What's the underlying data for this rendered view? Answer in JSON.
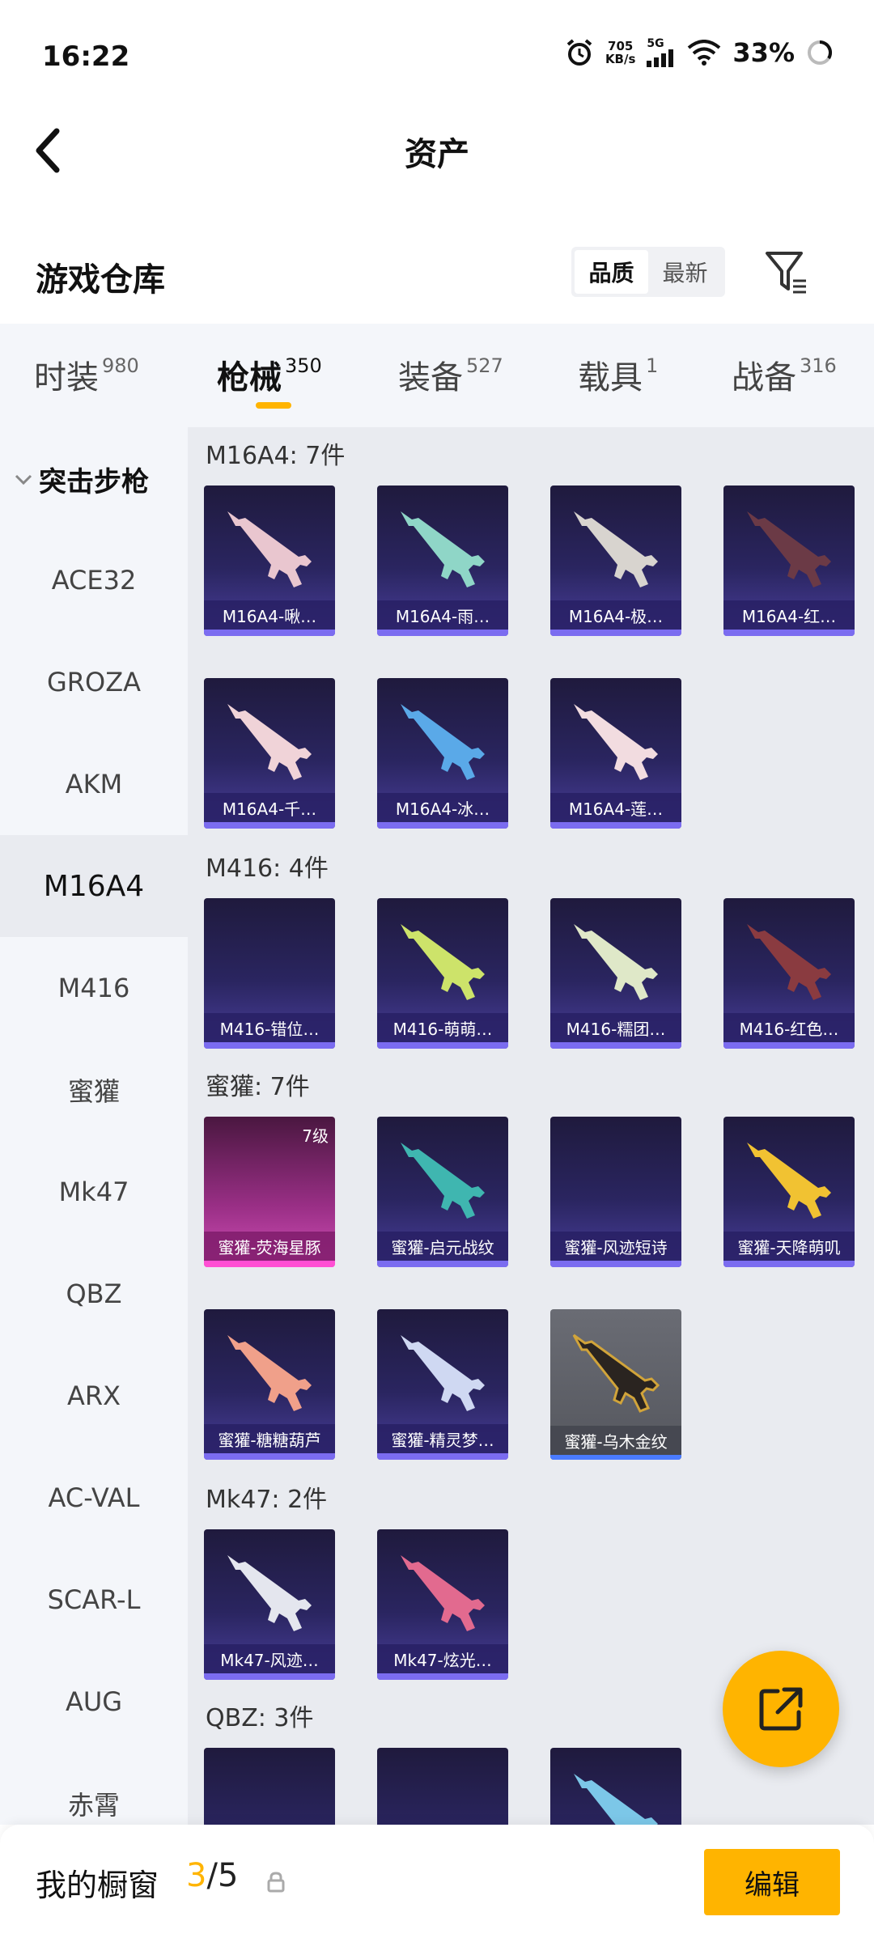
{
  "status_bar": {
    "time": "16:22",
    "net_speed_value": "705",
    "net_speed_unit": "KB/s",
    "network": "5G",
    "battery": "33%"
  },
  "header": {
    "title": "资产"
  },
  "warehouse": {
    "title": "游戏仓库",
    "sort_options": [
      "品质",
      "最新"
    ],
    "active_sort": "品质"
  },
  "tabs": [
    {
      "label": "时装",
      "count": "980"
    },
    {
      "label": "枪械",
      "count": "350"
    },
    {
      "label": "装备",
      "count": "527"
    },
    {
      "label": "载具",
      "count": "1"
    },
    {
      "label": "战备",
      "count": "316"
    }
  ],
  "active_tab": "枪械",
  "sidebar": {
    "group": "突击步枪",
    "items": [
      "ACE32",
      "GROZA",
      "AKM",
      "M16A4",
      "M416",
      "蜜獾",
      "Mk47",
      "QBZ",
      "ARX",
      "AC-VAL",
      "SCAR-L",
      "AUG",
      "赤霄"
    ],
    "active": "M16A4"
  },
  "sections": [
    {
      "title": "M16A4: 7件",
      "items": [
        "M16A4-啾…",
        "M16A4-雨…",
        "M16A4-极…",
        "M16A4-红…",
        "M16A4-千…",
        "M16A4-冰…",
        "M16A4-莲…"
      ]
    },
    {
      "title": "M416: 4件",
      "items": [
        "M416-错位…",
        "M416-萌萌…",
        "M416-糯团…",
        "M416-红色…"
      ]
    },
    {
      "title": "蜜獾: 7件",
      "items": [
        "蜜獾-荧海星豚",
        "蜜獾-启元战纹",
        "蜜獾-风迹短诗",
        "蜜獾-天降萌叽",
        "蜜獾-糖糖葫芦",
        "蜜獾-精灵梦…",
        "蜜獾-乌木金纹"
      ],
      "level_badge": "7级"
    },
    {
      "title": "Mk47: 2件",
      "items": [
        "Mk47-风迹…",
        "Mk47-炫光…"
      ]
    },
    {
      "title": "QBZ: 3件",
      "items": [
        "",
        "",
        ""
      ]
    }
  ],
  "colors": {
    "accent": "#ffb400",
    "card_purple": "#2a2560",
    "card_pink": "#d04fb6"
  },
  "bottom_bar": {
    "label": "我的橱窗",
    "current": "3",
    "separator": "/",
    "total": "5",
    "edit_label": "编辑"
  }
}
